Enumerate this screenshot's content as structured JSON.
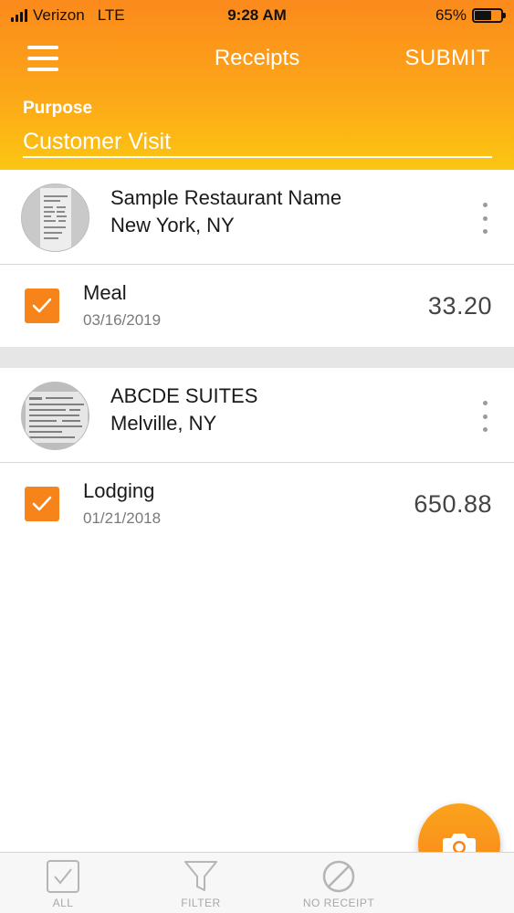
{
  "status_bar": {
    "carrier": "Verizon",
    "network": "LTE",
    "time": "9:28 AM",
    "battery_percent": "65%",
    "battery_level": 0.65
  },
  "header": {
    "title": "Receipts",
    "submit_label": "SUBMIT",
    "purpose_label": "Purpose",
    "purpose_value": "Customer Visit"
  },
  "receipts": [
    {
      "merchant_name": "Sample Restaurant Name",
      "location": "New York, NY",
      "category": "Meal",
      "date": "03/16/2019",
      "amount": "33.20",
      "checked": true
    },
    {
      "merchant_name": "ABCDE SUITES",
      "location": "Melville, NY",
      "category": "Lodging",
      "date": "01/21/2018",
      "amount": "650.88",
      "checked": true
    }
  ],
  "tabs": [
    {
      "label": "ALL",
      "icon": "checkbox-icon"
    },
    {
      "label": "FILTER",
      "icon": "filter-icon"
    },
    {
      "label": "NO RECEIPT",
      "icon": "no-receipt-icon"
    }
  ],
  "fab_icon": "camera-icon",
  "colors": {
    "accent": "#f7841a",
    "header_top": "#fb8a1c",
    "header_bottom": "#fbc612"
  }
}
